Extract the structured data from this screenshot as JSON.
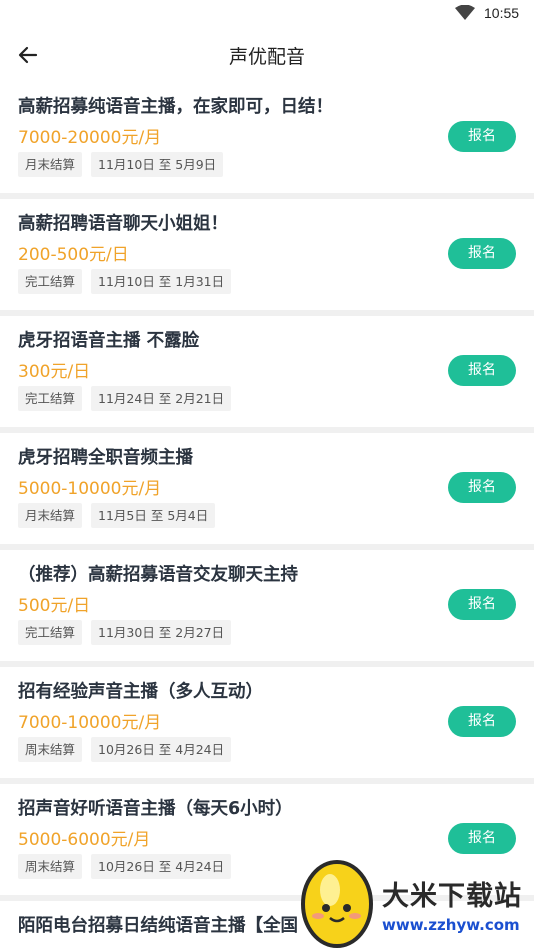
{
  "status": {
    "time": "10:55"
  },
  "header": {
    "title": "声优配音"
  },
  "apply_label": "报名",
  "jobs": [
    {
      "title": "高薪招募纯语音主播，在家即可，日结！",
      "salary": "7000-20000元/月",
      "settlement": "月末结算",
      "period": "11月10日 至 5月9日"
    },
    {
      "title": "高薪招聘语音聊天小姐姐！",
      "salary": "200-500元/日",
      "settlement": "完工结算",
      "period": "11月10日 至 1月31日"
    },
    {
      "title": "虎牙招语音主播 不露脸",
      "salary": "300元/日",
      "settlement": "完工结算",
      "period": "11月24日 至 2月21日"
    },
    {
      "title": " 虎牙招聘全职音频主播",
      "salary": "5000-10000元/月",
      "settlement": "月末结算",
      "period": "11月5日 至 5月4日"
    },
    {
      "title": "（推荐）高薪招募语音交友聊天主持",
      "salary": "500元/日",
      "settlement": "完工结算",
      "period": "11月30日 至 2月27日"
    },
    {
      "title": "招有经验声音主播（多人互动）",
      "salary": "7000-10000元/月",
      "settlement": "周末结算",
      "period": "10月26日 至 4月24日"
    },
    {
      "title": "招声音好听语音主播（每天6小时）",
      "salary": "5000-6000元/月",
      "settlement": "周末结算",
      "period": "10月26日 至 4月24日"
    },
    {
      "title": "陌陌电台招募日结纯语音主播【全国",
      "salary": "",
      "settlement": "",
      "period": ""
    }
  ],
  "watermark": {
    "brand": "大米下载站",
    "url": "www.zzhyw.com"
  },
  "colors": {
    "accent": "#1fbf98",
    "salary": "#f0a32a"
  }
}
